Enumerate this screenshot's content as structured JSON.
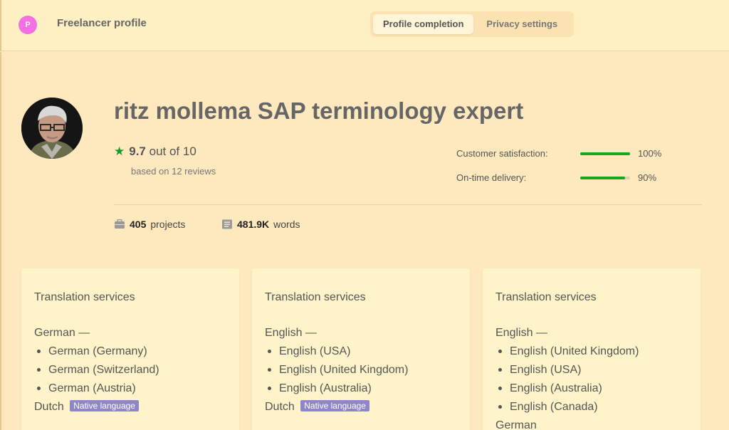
{
  "header": {
    "avatar_initial": "P",
    "title": "Freelancer profile",
    "tabs": [
      {
        "label": "Profile completion",
        "active": true
      },
      {
        "label": "Privacy settings",
        "active": false
      }
    ]
  },
  "profile": {
    "name": "ritz mollema SAP terminology expert",
    "rating_value": "9.7",
    "rating_suffix": "out of 10",
    "reviews": "based on 12 reviews",
    "metrics": [
      {
        "label": "Customer satisfaction:",
        "percent": 100,
        "display": "100%"
      },
      {
        "label": "On-time delivery:",
        "percent": 90,
        "display": "90%"
      }
    ],
    "stats": {
      "projects_value": "405",
      "projects_label": "projects",
      "words_value": "481.9K",
      "words_label": "words"
    }
  },
  "cards": [
    {
      "title": "Translation services",
      "source": "German —",
      "targets": [
        "German (Germany)",
        "German (Switzerland)",
        "German (Austria)"
      ],
      "extra_language": "Dutch",
      "badge": "Native language"
    },
    {
      "title": "Translation services",
      "source": "English —",
      "targets": [
        "English (USA)",
        "English (United Kingdom)",
        "English (Australia)"
      ],
      "extra_language": "Dutch",
      "badge": "Native language"
    },
    {
      "title": "Translation services",
      "source": "English —",
      "targets": [
        "English (United Kingdom)",
        "English (USA)",
        "English (Australia)",
        "English (Canada)"
      ],
      "extra_language": "German",
      "badge": ""
    }
  ],
  "colors": {
    "background": "#fde9bd",
    "accent_green": "#14a81a",
    "badge": "#8f86c9",
    "avatar": "#f46fe3"
  },
  "icons": [
    "star-icon",
    "briefcase-icon",
    "document-icon"
  ]
}
